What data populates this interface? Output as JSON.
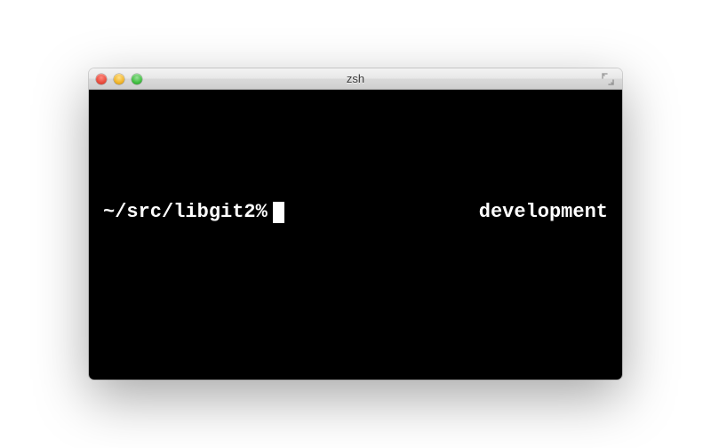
{
  "window": {
    "title": "zsh"
  },
  "terminal": {
    "prompt": "~/src/libgit2%",
    "rprompt": "development"
  }
}
